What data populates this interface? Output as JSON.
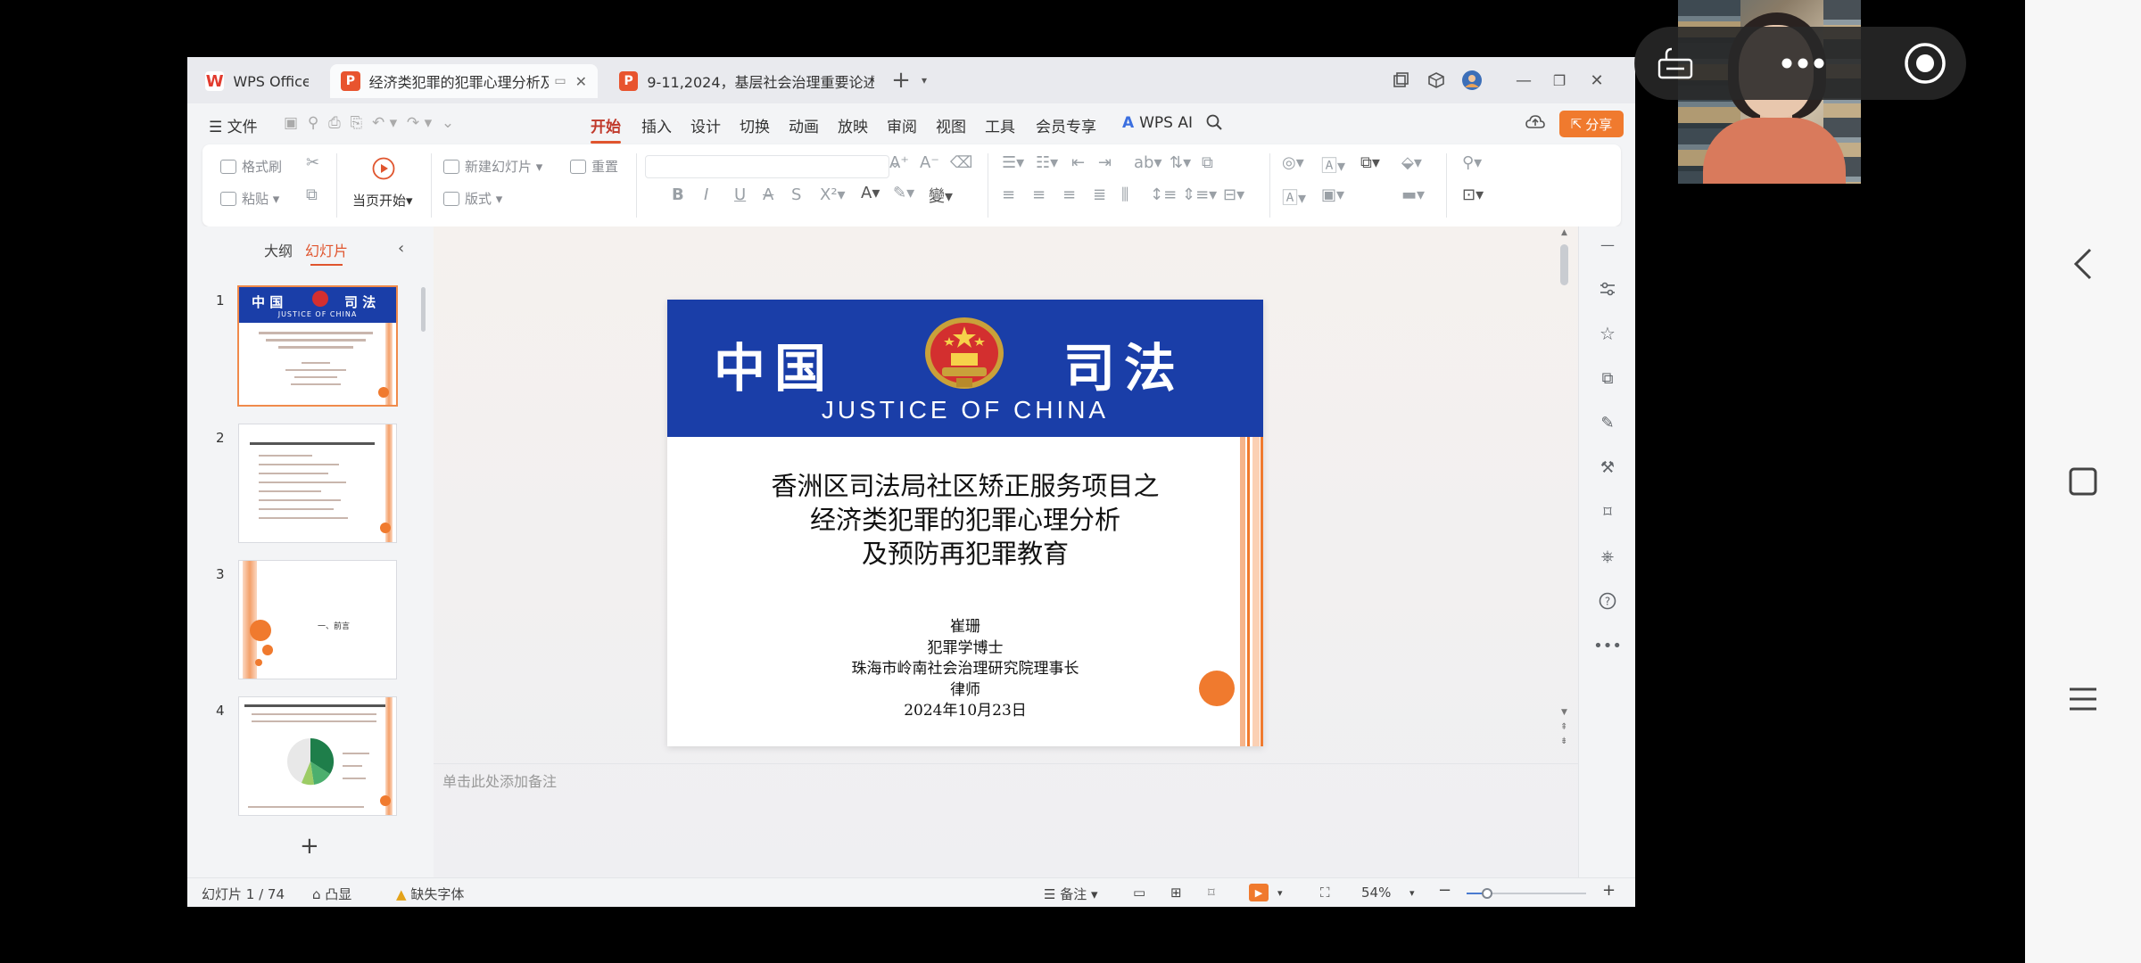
{
  "tabs": [
    {
      "label": "WPS Office"
    },
    {
      "label": "经济类犯罪的犯罪心理分析及预防再犯罪教育"
    },
    {
      "label": "9-11,2024，基层社会治理重要论述"
    }
  ],
  "menu": {
    "file": "文件",
    "items": [
      "开始",
      "插入",
      "设计",
      "切换",
      "动画",
      "放映",
      "审阅",
      "视图",
      "工具",
      "会员专享"
    ],
    "wps_ai": "WPS AI",
    "share": "分享"
  },
  "ribbon": {
    "format_painter": "格式刷",
    "paste": "粘贴",
    "play_from_current": "当页开始",
    "new_slide": "新建幻灯片",
    "reset": "重置",
    "layout": "版式"
  },
  "left_panel": {
    "outline_tab": "大纲",
    "slides_tab": "幻灯片",
    "thumbs": [
      {
        "num": "1",
        "h1": "中 国",
        "h2": "司 法",
        "sub": "JUSTICE OF CHINA"
      },
      {
        "num": "2"
      },
      {
        "num": "3",
        "label": "一、前言"
      },
      {
        "num": "4"
      }
    ],
    "add": "+"
  },
  "slide": {
    "header_left": "中国",
    "header_right": "司法",
    "header_en": "JUSTICE OF CHINA",
    "title_line1": "香洲区司法局社区矫正服务项目之",
    "title_line2": "经济类犯罪的犯罪心理分析",
    "title_line3": "及预防再犯罪教育",
    "author": "崔珊",
    "degree": "犯罪学博士",
    "position": "珠海市岭南社会治理研究院理事长",
    "job": "律师",
    "date": "2024年10月23日"
  },
  "notes_placeholder": "单击此处添加备注",
  "status": {
    "slide_counter": "幻灯片 1 / 74",
    "smart_art": "凸显",
    "missing_font": "缺失字体",
    "notes_btn": "备注",
    "zoom": "54%",
    "zoom_level": 0.54
  },
  "colors": {
    "accent": "#f07a2e",
    "active_menu": "#c0392b",
    "slide_header": "#1a3ea8"
  }
}
